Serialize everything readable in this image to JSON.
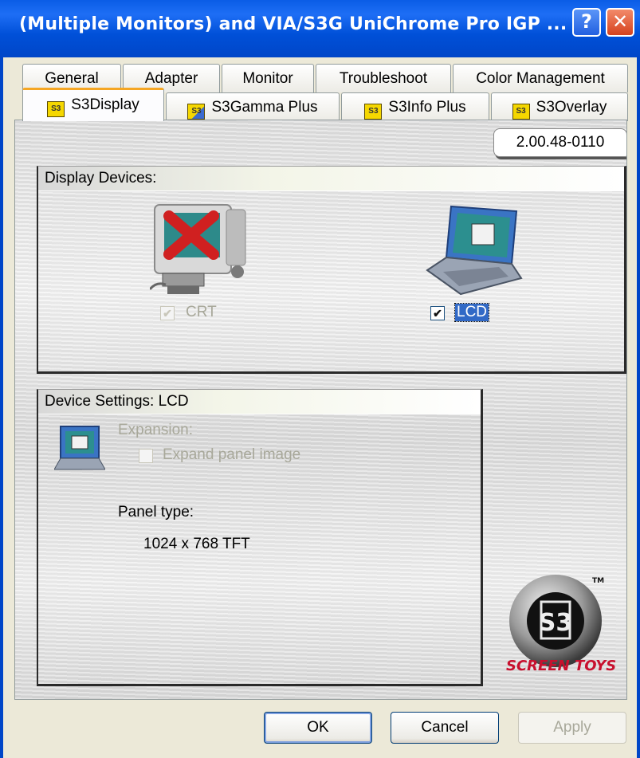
{
  "window": {
    "title": "(Multiple Monitors) and VIA/S3G UniChrome Pro IGP ...",
    "help_label": "?",
    "close_label": "✕"
  },
  "tabs_row1": [
    "General",
    "Adapter",
    "Monitor",
    "Troubleshoot",
    "Color Management"
  ],
  "tabs_row2": [
    "S3Display",
    "S3Gamma Plus",
    "S3Info Plus",
    "S3Overlay"
  ],
  "active_tab": "S3Display",
  "version": "2.00.48-0110",
  "display_devices": {
    "title": "Display Devices:",
    "crt": {
      "label": "CRT",
      "checked": true,
      "enabled": false,
      "icon": "crt-monitor-disabled-icon"
    },
    "lcd": {
      "label": "LCD",
      "checked": true,
      "enabled": true,
      "selected": true,
      "icon": "laptop-icon"
    }
  },
  "device_settings": {
    "title": "Device Settings: LCD",
    "expansion_label": "Expansion:",
    "expand_panel_label": "Expand panel image",
    "expand_checked": false,
    "panel_type_label": "Panel type:",
    "panel_type_value": "1024 x 768 TFT",
    "icon": "small-laptop-icon"
  },
  "logo": {
    "brand": "S3",
    "tagline": "SCREEN TOYS",
    "tm": "TM"
  },
  "buttons": {
    "ok": "OK",
    "cancel": "Cancel",
    "apply": "Apply"
  },
  "check_mark": "✔"
}
